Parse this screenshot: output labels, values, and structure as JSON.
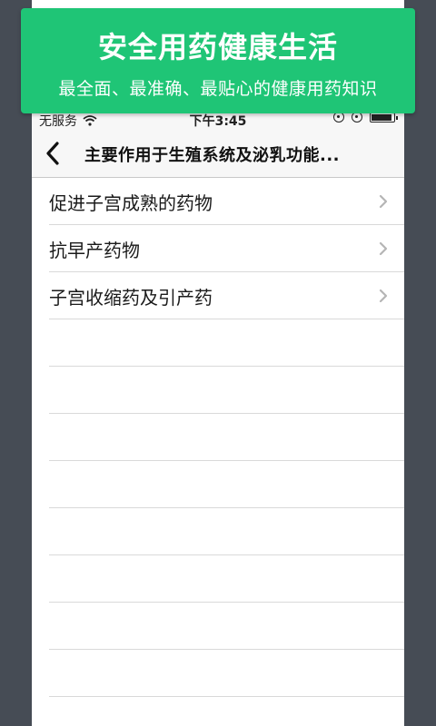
{
  "banner": {
    "title": "安全用药健康生活",
    "subtitle": "最全面、最准确、最贴心的健康用药知识"
  },
  "status_bar": {
    "carrier": "无服务",
    "time": "下午3:45",
    "wifi_icon": "wifi-icon",
    "battery_icon": "battery-icon"
  },
  "nav": {
    "back_icon": "chevron-left-icon",
    "title": "主要作用于生殖系统及泌乳功能..."
  },
  "list": {
    "items": [
      {
        "label": "促进子宫成熟的药物"
      },
      {
        "label": "抗早产药物"
      },
      {
        "label": "子宫收缩药及引产药"
      }
    ],
    "empty_rows": 8,
    "chevron_icon": "chevron-right-icon"
  },
  "colors": {
    "banner": "#1fc576",
    "background": "#464c55",
    "nav_bar": "#f7f7f7"
  }
}
